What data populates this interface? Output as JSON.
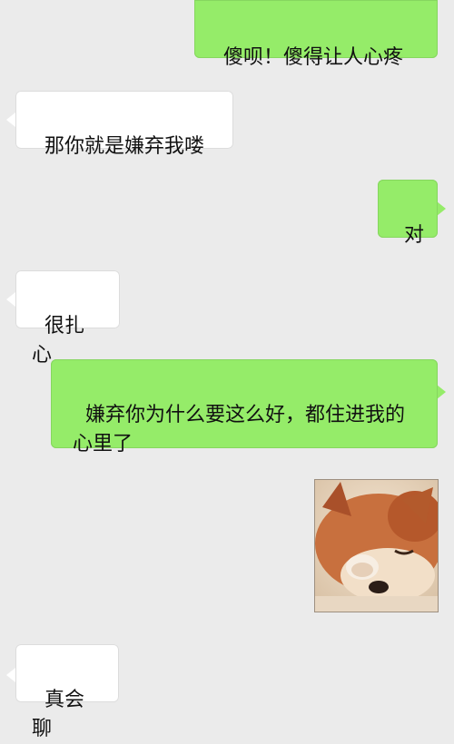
{
  "messages": [
    {
      "side": "sent",
      "text": "傻呗！傻得让人心疼"
    },
    {
      "side": "received",
      "text": "那你就是嫌弃我喽"
    },
    {
      "side": "sent",
      "text": "对"
    },
    {
      "side": "received",
      "text": "很扎心"
    },
    {
      "side": "sent",
      "text": "嫌弃你为什么要这么好，都住进我的心里了"
    },
    {
      "side": "sent",
      "sticker": "shiba-covering-face-sticker"
    },
    {
      "side": "received",
      "text": "真会聊"
    }
  ],
  "colors": {
    "sent_bubble": "#95ec69",
    "received_bubble": "#ffffff",
    "background": "#ebebeb"
  }
}
